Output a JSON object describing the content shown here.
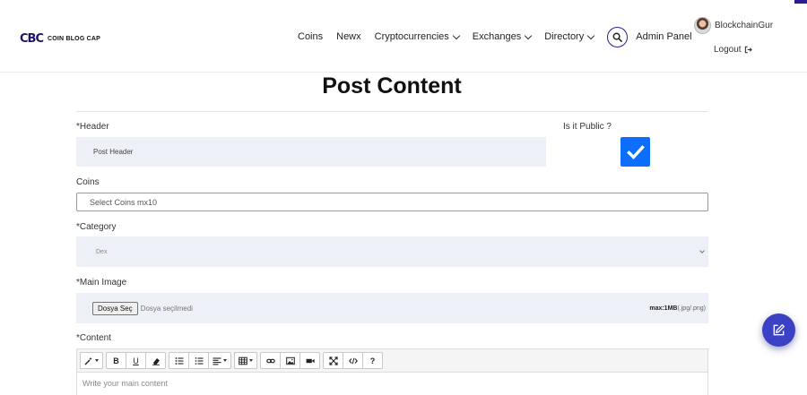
{
  "brand": {
    "mark": "CBC",
    "name": "COIN BLOG CAP"
  },
  "nav": {
    "items": [
      {
        "label": "Coins",
        "dropdown": false
      },
      {
        "label": "Newx",
        "dropdown": false
      },
      {
        "label": "Cryptocurrencies",
        "dropdown": true
      },
      {
        "label": "Exchanges",
        "dropdown": true
      },
      {
        "label": "Directory",
        "dropdown": true
      }
    ],
    "admin_label": "Admin Panel"
  },
  "user": {
    "name": "BlockchainGur",
    "logout_label": "Logout"
  },
  "page": {
    "title": "Post Content"
  },
  "form": {
    "header": {
      "label": "*Header",
      "placeholder": "Post Header"
    },
    "is_public": {
      "label": "Is it Public ?",
      "checked": true
    },
    "coins": {
      "label": "Coins",
      "placeholder": "Select Coins mx10"
    },
    "category": {
      "label": "*Category",
      "selected": "Dex"
    },
    "main_image": {
      "label": "*Main Image",
      "button_label": "Dosya Seç",
      "status": "Dosya seçilmedi",
      "limit_bold": "max:1MB",
      "limit_rest": "(.jpg/.png)"
    },
    "content": {
      "label": "*Content",
      "placeholder": "Write your main content"
    }
  },
  "colors": {
    "accent": "#2a1d8f",
    "checkbox": "#0d6efd",
    "fab": "#3b41c5",
    "field_bg": "#eef0f7"
  }
}
